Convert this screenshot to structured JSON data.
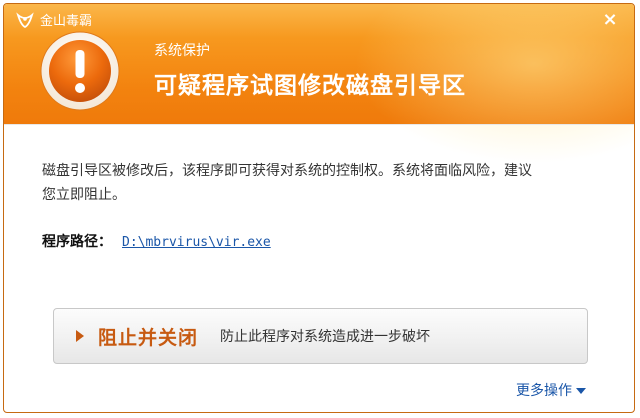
{
  "window": {
    "brand_name": "金山毒霸",
    "brand_icon": "kingsoft-logo-icon",
    "close_glyph": "×"
  },
  "alert": {
    "icon": "alert-exclamation-icon",
    "subtitle": "系统保护",
    "title": "可疑程序试图修改磁盘引导区",
    "header_color": "#f3830f"
  },
  "message": {
    "line1": "磁盘引导区被修改后，该程序即可获得对系统的控制权。系统将面临风险，建议",
    "line2": "您立即阻止。"
  },
  "program_path": {
    "label": "程序路径：",
    "value": "D:\\mbrvirus\\vir.exe"
  },
  "action": {
    "label": "阻止并关闭",
    "description": "防止此程序对系统造成进一步破坏",
    "accent_color": "#c75a11"
  },
  "more": {
    "label": "更多操作"
  }
}
